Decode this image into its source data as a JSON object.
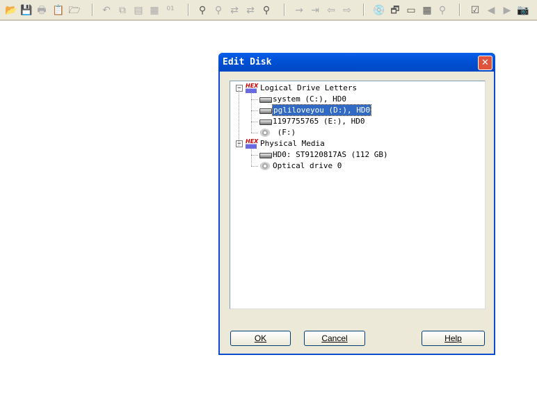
{
  "toolbar": {
    "icons": [
      {
        "name": "open-folder-icon",
        "glyph": "📂",
        "disabled": false
      },
      {
        "name": "save-icon",
        "glyph": "💾",
        "disabled": true
      },
      {
        "name": "print-icon",
        "glyph": "🖶",
        "disabled": true
      },
      {
        "name": "properties-icon",
        "glyph": "📋",
        "disabled": false
      },
      {
        "name": "open-folder-multiple-icon",
        "glyph": "🗁",
        "disabled": false
      },
      {
        "name": "undo-icon",
        "glyph": "↶",
        "disabled": true
      },
      {
        "name": "copy-icon",
        "glyph": "⧉",
        "disabled": true
      },
      {
        "name": "cut-icon",
        "glyph": "▤",
        "disabled": true
      },
      {
        "name": "paste-icon",
        "glyph": "▦",
        "disabled": true
      },
      {
        "name": "binary-icon",
        "glyph": "⁰¹",
        "disabled": true
      },
      {
        "name": "find-icon",
        "glyph": "⚲",
        "disabled": false
      },
      {
        "name": "find-hex-icon",
        "glyph": "⚲",
        "disabled": true
      },
      {
        "name": "replace-icon",
        "glyph": "⇄",
        "disabled": true
      },
      {
        "name": "replace-hex-icon",
        "glyph": "⇄",
        "disabled": true
      },
      {
        "name": "find-again-icon",
        "glyph": "⚲",
        "disabled": false
      },
      {
        "name": "go-to-offset-icon",
        "glyph": "→",
        "disabled": true
      },
      {
        "name": "go-to-sector-icon",
        "glyph": "⇥",
        "disabled": true
      },
      {
        "name": "back-icon",
        "glyph": "⇦",
        "disabled": true
      },
      {
        "name": "forward-icon",
        "glyph": "⇨",
        "disabled": true
      },
      {
        "name": "edit-disk-icon",
        "glyph": "💿",
        "disabled": false
      },
      {
        "name": "open-ram-icon",
        "glyph": "🗗",
        "disabled": false
      },
      {
        "name": "ram-icon",
        "glyph": "▭",
        "disabled": false
      },
      {
        "name": "calculator-icon",
        "glyph": "▦",
        "disabled": false
      },
      {
        "name": "view-icon",
        "glyph": "⚲",
        "disabled": true
      },
      {
        "name": "checksum-icon",
        "glyph": "☑",
        "disabled": false
      },
      {
        "name": "previous-icon",
        "glyph": "◀",
        "disabled": true
      },
      {
        "name": "next-icon",
        "glyph": "▶",
        "disabled": true
      },
      {
        "name": "snapshot-icon",
        "glyph": "📷",
        "disabled": true
      }
    ]
  },
  "dialog": {
    "title": "Edit Disk",
    "close_glyph": "✕",
    "tree": {
      "groups": [
        {
          "label": "Logical Drive Letters",
          "icon": "hex-workshop-icon",
          "items": [
            {
              "label": "system (C:), HD0",
              "icon": "hard-drive-icon"
            },
            {
              "label": "pgliloveyou (D:), HD0",
              "icon": "hard-drive-icon",
              "selected": true
            },
            {
              "label": "1197755765 (E:), HD0",
              "icon": "hard-drive-icon"
            },
            {
              "label": " (F:)",
              "icon": "optical-drive-icon"
            }
          ]
        },
        {
          "label": "Physical Media",
          "icon": "hex-workshop-icon",
          "items": [
            {
              "label": "HD0: ST9120817AS (112 GB)",
              "icon": "hard-drive-icon"
            },
            {
              "label": "Optical drive 0",
              "icon": "optical-drive-icon"
            }
          ]
        }
      ]
    },
    "buttons": {
      "ok": "OK",
      "cancel": "Cancel",
      "help": "Help"
    }
  },
  "colors": {
    "titlebar": "#0054e3",
    "selection": "#316ac5",
    "close": "#e0533d"
  }
}
